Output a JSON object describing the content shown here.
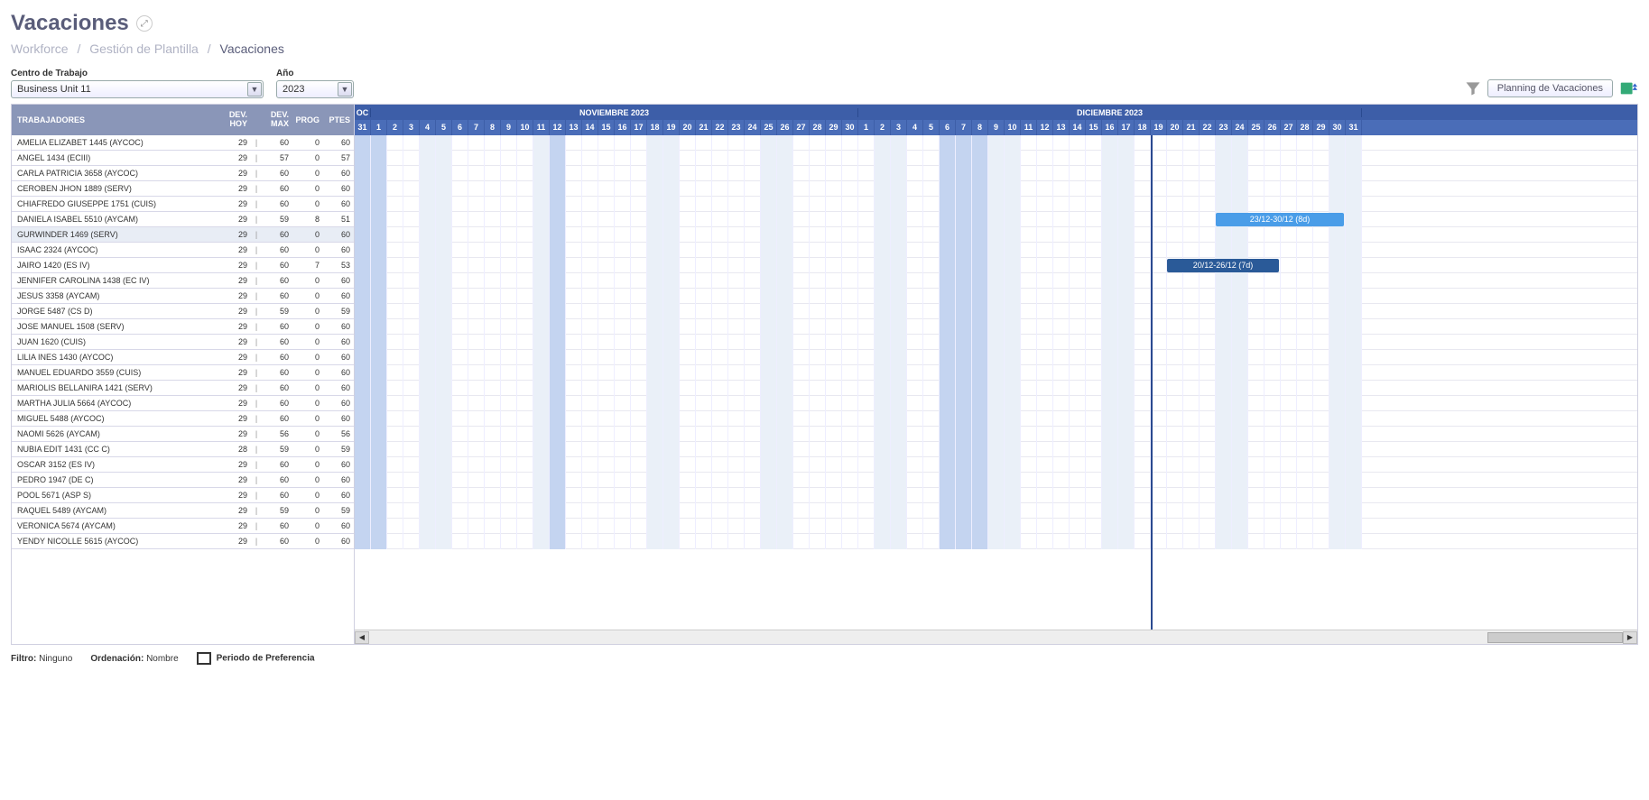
{
  "page": {
    "title": "Vacaciones"
  },
  "breadcrumb": {
    "items": [
      "Workforce",
      "Gestión de Plantilla"
    ],
    "current": "Vacaciones"
  },
  "filters": {
    "centro": {
      "label": "Centro de Trabajo",
      "value": "Business Unit 11"
    },
    "ano": {
      "label": "Año",
      "value": "2023"
    }
  },
  "actions": {
    "planning": "Planning de Vacaciones"
  },
  "columns": {
    "trabajadores": "TRABAJADORES",
    "dev_hoy_l1": "DEV.",
    "dev_hoy_l2": "HOY",
    "dev_max_l1": "DEV.",
    "dev_max_l2": "MAX",
    "prog": "PROG",
    "ptes": "PTES"
  },
  "months": {
    "oct_short": "OC",
    "nov": "NOVIEMBRE 2023",
    "dic": "DICIEMBRE 2023"
  },
  "days": {
    "oct": [
      31
    ],
    "nov": [
      1,
      2,
      3,
      4,
      5,
      6,
      7,
      8,
      9,
      10,
      11,
      12,
      13,
      14,
      15,
      16,
      17,
      18,
      19,
      20,
      21,
      22,
      23,
      24,
      25,
      26,
      27,
      28,
      29,
      30
    ],
    "dic": [
      1,
      2,
      3,
      4,
      5,
      6,
      7,
      8,
      9,
      10,
      11,
      12,
      13,
      14,
      15,
      16,
      17,
      18,
      19,
      20,
      21,
      22,
      23,
      24,
      25,
      26,
      27,
      28,
      29,
      30,
      31
    ]
  },
  "weekend_nov": [
    4,
    5,
    11,
    12,
    18,
    19,
    25,
    26
  ],
  "weekend_dic": [
    2,
    3,
    9,
    10,
    16,
    17,
    23,
    24,
    30,
    31
  ],
  "holiday_nov_zone": [
    1,
    12
  ],
  "holiday_dic_zone": [
    6,
    7,
    8
  ],
  "today": "2023-12-19",
  "workers": [
    {
      "name": "AMELIA ELIZABET 1445 (AYCOC)",
      "dev_hoy": 29,
      "dev_max": 60,
      "prog": 0,
      "ptes": 60
    },
    {
      "name": "ANGEL 1434 (ECIII)",
      "dev_hoy": 29,
      "dev_max": 57,
      "prog": 0,
      "ptes": 57
    },
    {
      "name": "CARLA PATRICIA 3658 (AYCOC)",
      "dev_hoy": 29,
      "dev_max": 60,
      "prog": 0,
      "ptes": 60
    },
    {
      "name": "CEROBEN JHON 1889 (SERV)",
      "dev_hoy": 29,
      "dev_max": 60,
      "prog": 0,
      "ptes": 60
    },
    {
      "name": "CHIAFREDO GIUSEPPE 1751 (CUIS)",
      "dev_hoy": 29,
      "dev_max": 60,
      "prog": 0,
      "ptes": 60
    },
    {
      "name": "DANIELA ISABEL 5510 (AYCAM)",
      "dev_hoy": 29,
      "dev_max": 59,
      "prog": 8,
      "ptes": 51,
      "bar": {
        "label": "23/12-30/12 (8d)",
        "start": 53,
        "len": 8,
        "class": ""
      }
    },
    {
      "name": "GURWINDER 1469 (SERV)",
      "dev_hoy": 29,
      "dev_max": 60,
      "prog": 0,
      "ptes": 60,
      "highlight": true
    },
    {
      "name": "ISAAC 2324 (AYCOC)",
      "dev_hoy": 29,
      "dev_max": 60,
      "prog": 0,
      "ptes": 60
    },
    {
      "name": "JAIRO 1420 (ES IV)",
      "dev_hoy": 29,
      "dev_max": 60,
      "prog": 7,
      "ptes": 53,
      "bar": {
        "label": "20/12-26/12 (7d)",
        "start": 50,
        "len": 7,
        "class": "dark"
      }
    },
    {
      "name": "JENNIFER CAROLINA 1438 (EC IV)",
      "dev_hoy": 29,
      "dev_max": 60,
      "prog": 0,
      "ptes": 60
    },
    {
      "name": "JESUS 3358 (AYCAM)",
      "dev_hoy": 29,
      "dev_max": 60,
      "prog": 0,
      "ptes": 60
    },
    {
      "name": "JORGE 5487 (CS D)",
      "dev_hoy": 29,
      "dev_max": 59,
      "prog": 0,
      "ptes": 59
    },
    {
      "name": "JOSE MANUEL 1508 (SERV)",
      "dev_hoy": 29,
      "dev_max": 60,
      "prog": 0,
      "ptes": 60
    },
    {
      "name": "JUAN 1620 (CUIS)",
      "dev_hoy": 29,
      "dev_max": 60,
      "prog": 0,
      "ptes": 60
    },
    {
      "name": "LILIA INES 1430 (AYCOC)",
      "dev_hoy": 29,
      "dev_max": 60,
      "prog": 0,
      "ptes": 60
    },
    {
      "name": "MANUEL EDUARDO 3559 (CUIS)",
      "dev_hoy": 29,
      "dev_max": 60,
      "prog": 0,
      "ptes": 60
    },
    {
      "name": "MARIOLIS BELLANIRA 1421 (SERV)",
      "dev_hoy": 29,
      "dev_max": 60,
      "prog": 0,
      "ptes": 60
    },
    {
      "name": "MARTHA JULIA 5664 (AYCOC)",
      "dev_hoy": 29,
      "dev_max": 60,
      "prog": 0,
      "ptes": 60
    },
    {
      "name": "MIGUEL 5488 (AYCOC)",
      "dev_hoy": 29,
      "dev_max": 60,
      "prog": 0,
      "ptes": 60
    },
    {
      "name": "NAOMI 5626 (AYCAM)",
      "dev_hoy": 29,
      "dev_max": 56,
      "prog": 0,
      "ptes": 56
    },
    {
      "name": "NUBIA EDIT 1431 (CC C)",
      "dev_hoy": 28,
      "dev_max": 59,
      "prog": 0,
      "ptes": 59
    },
    {
      "name": "OSCAR 3152 (ES IV)",
      "dev_hoy": 29,
      "dev_max": 60,
      "prog": 0,
      "ptes": 60
    },
    {
      "name": "PEDRO 1947 (DE C)",
      "dev_hoy": 29,
      "dev_max": 60,
      "prog": 0,
      "ptes": 60
    },
    {
      "name": "POOL 5671 (ASP S)",
      "dev_hoy": 29,
      "dev_max": 60,
      "prog": 0,
      "ptes": 60
    },
    {
      "name": "RAQUEL 5489 (AYCAM)",
      "dev_hoy": 29,
      "dev_max": 59,
      "prog": 0,
      "ptes": 59
    },
    {
      "name": "VERONICA 5674 (AYCAM)",
      "dev_hoy": 29,
      "dev_max": 60,
      "prog": 0,
      "ptes": 60
    },
    {
      "name": "YENDY NICOLLE 5615 (AYCOC)",
      "dev_hoy": 29,
      "dev_max": 60,
      "prog": 0,
      "ptes": 60
    }
  ],
  "footer": {
    "filtro_label": "Filtro:",
    "filtro_value": "Ninguno",
    "orden_label": "Ordenación:",
    "orden_value": "Nombre",
    "legend": "Periodo de Preferencia"
  }
}
